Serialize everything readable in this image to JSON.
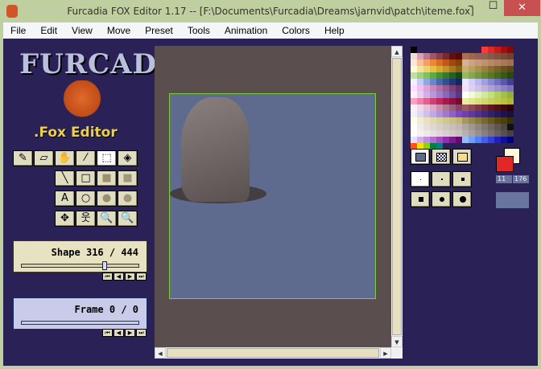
{
  "window": {
    "title": "Furcadia FOX Editor 1.17 -- [F:\\Documents\\Furcadia\\Dreams\\jarnvid\\patch\\iteme.fox]",
    "minimize": "–",
    "maximize": "☐",
    "close": "✕"
  },
  "menu": [
    "File",
    "Edit",
    "View",
    "Move",
    "Preset",
    "Tools",
    "Animation",
    "Colors",
    "Help"
  ],
  "logo": {
    "title": "FURCADIA",
    "subtitle": ".Fox Editor"
  },
  "tools": [
    {
      "name": "pencil",
      "glyph": "✎"
    },
    {
      "name": "eraser",
      "glyph": "▱"
    },
    {
      "name": "hand",
      "glyph": "✋"
    },
    {
      "name": "eyedropper",
      "glyph": "⁄"
    },
    {
      "name": "select",
      "glyph": "⬚"
    },
    {
      "name": "fill",
      "glyph": "◈"
    },
    {
      "name": "line",
      "glyph": "╲"
    },
    {
      "name": "rectangle",
      "glyph": "□"
    },
    {
      "name": "filled-rectangle",
      "glyph": "■"
    },
    {
      "name": "filled-rectangle-noborder",
      "glyph": "■"
    },
    {
      "name": "text",
      "glyph": "A"
    },
    {
      "name": "ellipse",
      "glyph": "○"
    },
    {
      "name": "filled-ellipse",
      "glyph": "●"
    },
    {
      "name": "filled-ellipse-noborder",
      "glyph": "●"
    },
    {
      "name": "move",
      "glyph": "✥"
    },
    {
      "name": "figure",
      "glyph": "웃"
    },
    {
      "name": "zoom-in",
      "glyph": "🔍"
    },
    {
      "name": "zoom-out",
      "glyph": "🔍"
    }
  ],
  "shape": {
    "label": "Shape 316 / 444",
    "current": 316,
    "total": 444
  },
  "frame": {
    "label": "Frame 0 / 0",
    "current": 0,
    "total": 0
  },
  "nav_buttons": [
    "⏮",
    "◀",
    "▶",
    "⏭"
  ],
  "colors": {
    "foreground": "#e02828",
    "background": "#fff8dc",
    "fg_index": "11",
    "bg_index": "176"
  },
  "palette": [
    [
      "#000000",
      "#2a2157",
      "#2a2157",
      "#2a2157",
      "#2a2157",
      "#2a2157",
      "#2a2157",
      "#2a2157",
      "#2a2157",
      "#2a2157",
      "#2a2157",
      "#ff3838",
      "#e02828",
      "#c81818",
      "#a80c0c",
      "#880808"
    ],
    [
      "#f0d8e0",
      "#d8a0b0",
      "#b87890",
      "#a05868",
      "#884050",
      "#782830",
      "#601010",
      "#580808",
      "#a87050",
      "#a06848",
      "#986050",
      "#906050",
      "#885848",
      "#805040",
      "#784838",
      "#704030"
    ],
    [
      "#fde8d8",
      "#f8c098",
      "#f0a068",
      "#e88838",
      "#d87020",
      "#c05818",
      "#a04810",
      "#884008",
      "#d8b098",
      "#d0a088",
      "#c89878",
      "#c09070",
      "#b88868",
      "#b08060",
      "#a87858",
      "#a07050"
    ],
    [
      "#fff8e0",
      "#f8e0a0",
      "#f0d070",
      "#e8c040",
      "#d8a830",
      "#c89028",
      "#a87820",
      "#886018",
      "#c8b070",
      "#b8a060",
      "#a89050",
      "#988040",
      "#887030",
      "#786028",
      "#685020",
      "#584818"
    ],
    [
      "#c0e0a0",
      "#a0d080",
      "#80c060",
      "#60a840",
      "#489030",
      "#387828",
      "#286020",
      "#184818",
      "#98b860",
      "#88a850",
      "#789840",
      "#688830",
      "#587828",
      "#486820",
      "#385818",
      "#284810"
    ],
    [
      "#f0f0ff",
      "#c0d0f0",
      "#90a8e0",
      "#6888c8",
      "#4868a8",
      "#305090",
      "#203878",
      "#102860",
      "#e8e8ff",
      "#d0d0f8",
      "#b8b8f0",
      "#a0a0e0",
      "#8888d0",
      "#7070c0",
      "#5858a8",
      "#404090"
    ],
    [
      "#fce0ff",
      "#f0c0f0",
      "#e0a0d8",
      "#c888c0",
      "#b070a8",
      "#985890",
      "#804078",
      "#683060",
      "#f0e0f8",
      "#e0d0f0",
      "#d0c0e8",
      "#c0b0e0",
      "#b0a0d8",
      "#a090d0",
      "#9080c8",
      "#8070c0"
    ],
    [
      "#fff0f8",
      "#e8d0f0",
      "#d0b0e8",
      "#b898d8",
      "#a080c8",
      "#8868b8",
      "#7050a0",
      "#583888",
      "#ffffff",
      "#f0f8e0",
      "#e0f0c0",
      "#d0e8a0",
      "#c0e080",
      "#b0d060",
      "#a0c050",
      "#90b040"
    ],
    [
      "#ffa0c0",
      "#f080a8",
      "#e06090",
      "#d04078",
      "#c02860",
      "#a81850",
      "#901040",
      "#780830",
      "#e8f0a0",
      "#e0e890",
      "#d8e080",
      "#d0d870",
      "#c8d060",
      "#c0c850",
      "#b8c040",
      "#b0b830"
    ],
    [
      "#f8f0f8",
      "#f0d8e8",
      "#e8c0d8",
      "#e0a8c8",
      "#c890a8",
      "#b07890",
      "#986078",
      "#804860",
      "#a05860",
      "#904850",
      "#803840",
      "#702830",
      "#601820",
      "#501010",
      "#400808",
      "#300000"
    ],
    [
      "#f0f0f8",
      "#e0d8f0",
      "#d0c0e8",
      "#c0a8e0",
      "#b090d8",
      "#a078d0",
      "#9060c8",
      "#8048c0",
      "#7040b0",
      "#6038a0",
      "#503090",
      "#402880",
      "#302070",
      "#281860",
      "#201050",
      "#181040"
    ],
    [
      "#fdfde8",
      "#f0ecd0",
      "#e8e0c0",
      "#e0d8b0",
      "#d8d0a0",
      "#d0c890",
      "#c8c080",
      "#c0b870",
      "#a89860",
      "#988850",
      "#887840",
      "#786830",
      "#685820",
      "#584810",
      "#484008",
      "#383000"
    ],
    [
      "#ffffff",
      "#f0ece8",
      "#e8e0d8",
      "#e0d8d0",
      "#d8d0c8",
      "#d0c8c0",
      "#c8c0b8",
      "#c0b8b0",
      "#b0a8a0",
      "#a09890",
      "#908880",
      "#807870",
      "#706860",
      "#605850",
      "#504840",
      "#101010"
    ],
    [
      "#ffffff",
      "#f8f0f0",
      "#f0e8e8",
      "#e8e0e0",
      "#e0d8d8",
      "#d8d0d0",
      "#d0c8c8",
      "#c8c0c0",
      "#b8b0b0",
      "#a8a0a0",
      "#989090",
      "#888080",
      "#787070",
      "#686060",
      "#585050",
      "#484040"
    ],
    [
      "#e8e0f8",
      "#d0b0f0",
      "#c090e0",
      "#b070d0",
      "#a050c0",
      "#9030b0",
      "#801890",
      "#680870",
      "#90c0f8",
      "#70a0f8",
      "#5080f8",
      "#4060f0",
      "#3040d8",
      "#2020c0",
      "#1010a0",
      "#000080"
    ],
    [
      "#ff5020",
      "#ffe000",
      "#90d010",
      "#008040",
      "#008080"
    ]
  ],
  "swatches": {
    "fill_modes": [
      "outline",
      "checker",
      "fill"
    ],
    "brush_sizes": [
      "1",
      "2",
      "3",
      "4",
      "5",
      "6"
    ]
  }
}
